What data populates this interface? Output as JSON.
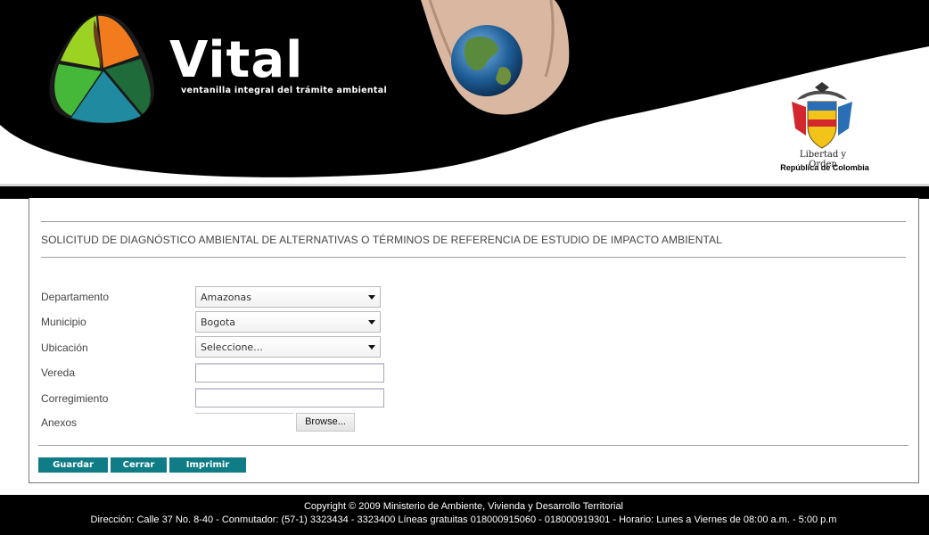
{
  "header": {
    "brand_name": "Vital",
    "brand_tagline": "ventanilla integral del trámite ambiental",
    "motto": "Libertad y Orden",
    "country": "República de Colombia"
  },
  "form": {
    "title": "SOLICITUD DE DIAGNÓSTICO AMBIENTAL DE ALTERNATIVAS O TÉRMINOS DE REFERENCIA DE ESTUDIO DE IMPACTO AMBIENTAL",
    "fields": {
      "departamento": {
        "label": "Departamento",
        "value": "Amazonas"
      },
      "municipio": {
        "label": "Municipio",
        "value": "Bogota"
      },
      "ubicacion": {
        "label": "Ubicación",
        "value": "Seleccione..."
      },
      "vereda": {
        "label": "Vereda",
        "value": ""
      },
      "corregimiento": {
        "label": "Corregimiento",
        "value": ""
      },
      "anexos": {
        "label": "Anexos",
        "browse_label": "Browse..."
      }
    },
    "buttons": {
      "guardar": "Guardar",
      "cerrar": "Cerrar",
      "imprimir": "Imprimir"
    }
  },
  "footer": {
    "copyright": "Copyright © 2009 Ministerio de Ambiente, Vivienda y Desarrollo Territorial",
    "contact": "Dirección: Calle 37 No. 8-40 - Conmutador: (57-1) 3323434 - 3323400 Líneas gratuitas 018000915060 - 018000919301 - Horario: Lunes a Viernes de 08:00 a.m. - 5:00 p.m"
  },
  "colors": {
    "button_bg": "#0f7c86",
    "banner_bg": "#000000"
  }
}
